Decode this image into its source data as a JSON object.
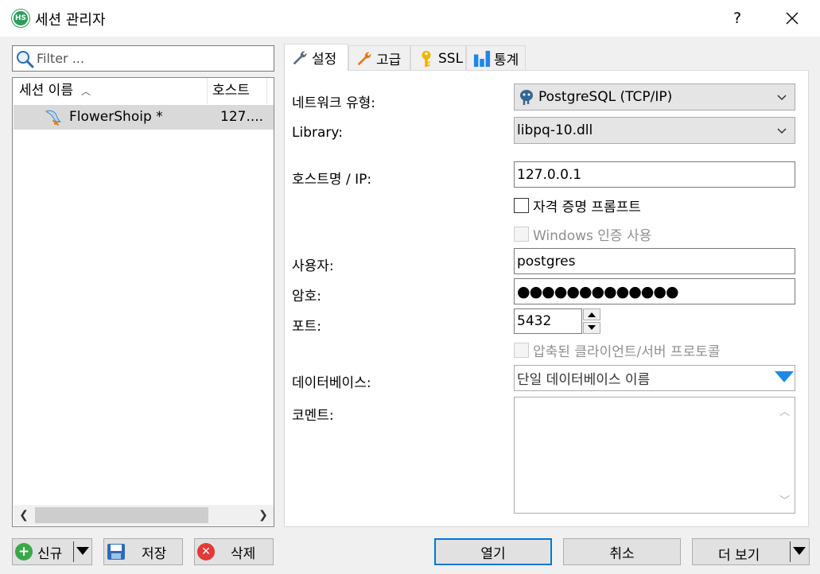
{
  "window": {
    "title": "세션 관리자",
    "icon_text": "HS",
    "help_label": "?"
  },
  "filter": {
    "placeholder": "Filter ..."
  },
  "session_list": {
    "columns": {
      "name": "세션 이름",
      "host": "호스트",
      "sort_arrow": "^"
    },
    "rows": [
      {
        "name": "FlowerShoip *",
        "host": "127...."
      }
    ]
  },
  "left_buttons": {
    "new": "신규",
    "save": "저장",
    "delete": "삭제"
  },
  "tabs": [
    {
      "label": "설정",
      "icon": "wrench-icon",
      "active": true
    },
    {
      "label": "고급",
      "icon": "wrench-icon"
    },
    {
      "label": "SSL",
      "icon": "key-icon"
    },
    {
      "label": "통계",
      "icon": "bar-chart-icon"
    }
  ],
  "settings": {
    "network_type": {
      "label": "네트워크 유형:",
      "value": "PostgreSQL (TCP/IP)"
    },
    "library": {
      "label": "Library:",
      "value": "libpq-10.dll"
    },
    "hostname": {
      "label": "호스트명 / IP:",
      "value": "127.0.0.1"
    },
    "credential_prompt": {
      "label": "자격 증명 프롬프트",
      "checked": false
    },
    "windows_auth": {
      "label": "Windows 인증 사용",
      "checked": false,
      "enabled": false
    },
    "user": {
      "label": "사용자:",
      "value": "postgres"
    },
    "password": {
      "label": "암호:",
      "value": "●●●●●●●●●●●●●"
    },
    "port": {
      "label": "포트:",
      "value": "5432"
    },
    "compressed": {
      "label": "압축된 클라이언트/서버 프로토콜",
      "checked": false,
      "enabled": false
    },
    "database": {
      "label": "데이터베이스:",
      "value": "단일 데이터베이스 이름"
    },
    "comment": {
      "label": "코멘트:",
      "value": ""
    }
  },
  "right_buttons": {
    "open": "열기",
    "cancel": "취소",
    "more": "더 보기"
  },
  "colors": {
    "accent": "#0078d7",
    "selection": "#d9d9d9",
    "dropdown_arrow": "#1e88e5",
    "new_icon": "#3aa84a",
    "delete_icon": "#e53935"
  }
}
